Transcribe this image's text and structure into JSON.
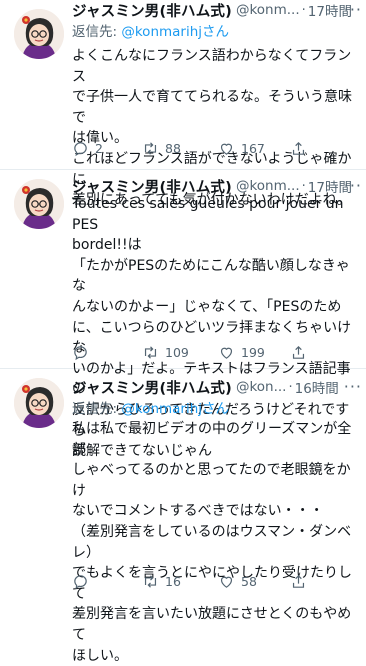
{
  "tweets": [
    {
      "name": "ジャスミン男(非ハム式)",
      "handle": "@konm...",
      "dot": "·",
      "time": "17時間",
      "reply_prefix": "返信先: ",
      "reply_to": "@konmarihjさん",
      "lines": [
        "よくこんなにフランス語わからなくてフランス",
        "で子供一人で育ててられるな。そういう意味で",
        "は偉い。",
        "これほどフランス語ができないようじゃ確かに",
        "差別にあってても気が付かないわけだよね。"
      ],
      "reply_count": "2",
      "retweet_count": "88",
      "like_count": "167"
    },
    {
      "name": "ジャスミン男(非ハム式)",
      "handle": "@konm...",
      "dot": "·",
      "time": "17時間",
      "lines": [
        "Toutes ces sales gueules pour jouer un PES",
        "bordel!!は",
        "「たかがPESのためにこんな酷い顔しなきゃな",
        "んないのかよー」じゃなくて、「PESのため",
        "に、こいつらのひどいツラ拝まなくちゃいけな",
        "いのかよ」だよ。テキストはフランス語記事の",
        "反訳からひろってきたんだろうけどそれですら",
        "読解できてないじゃん"
      ],
      "reply_count": "",
      "retweet_count": "109",
      "like_count": "199"
    },
    {
      "name": "ジャスミン男(非ハム式)",
      "handle": "@kon...",
      "dot": "·",
      "time": "16時間",
      "reply_prefix": "返信先: ",
      "reply_to": "@konmarihjさん",
      "lines": [
        "私は私で最初ビデオの中のグリーズマンが全部",
        "しゃべってるのかと思ってたので老眼鏡をかけ",
        "ないでコメントするべきではない・・・",
        "（差別発言をしているのはウスマン・ダンベレ）",
        "でもよくを言うとにやにやしたり受けたりして",
        "差別発言を言いたい放題にさせとくのもやめて",
        "ほしい。"
      ],
      "reply_count": "",
      "retweet_count": "16",
      "like_count": "58"
    }
  ],
  "icons": {
    "more": "more-icon",
    "reply": "reply-icon",
    "retweet": "retweet-icon",
    "like": "like-icon",
    "share": "share-icon"
  },
  "colors": {
    "link": "#1d9bf0",
    "secondary": "#536471",
    "text": "#0f1419",
    "divider": "#e6ecf0"
  }
}
